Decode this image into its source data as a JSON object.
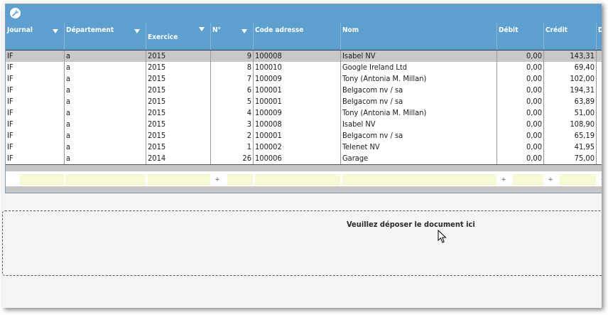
{
  "toolbar": {
    "icon": "wrench-icon"
  },
  "columns": [
    {
      "key": "journal",
      "label": "Journal",
      "sortable": true
    },
    {
      "key": "departement",
      "label": "Département",
      "sortable": true
    },
    {
      "key": "exercice",
      "label": "Exercice",
      "sortable": true
    },
    {
      "key": "numero",
      "label": "N°",
      "sortable": true
    },
    {
      "key": "code_adresse",
      "label": "Code adresse",
      "sortable": false
    },
    {
      "key": "nom",
      "label": "Nom",
      "sortable": false
    },
    {
      "key": "debit",
      "label": "Débit",
      "sortable": false
    },
    {
      "key": "credit",
      "label": "Crédit",
      "sortable": false
    },
    {
      "key": "extra",
      "label": "D",
      "sortable": false
    }
  ],
  "rows": [
    {
      "journal": "IF",
      "departement": "a",
      "exercice": "2015",
      "numero": "9",
      "code_adresse": "100008",
      "nom": "Isabel NV",
      "debit": "0,00",
      "credit": "143,31",
      "selected": true
    },
    {
      "journal": "IF",
      "departement": "a",
      "exercice": "2015",
      "numero": "8",
      "code_adresse": "100010",
      "nom": "Google Ireland Ltd",
      "debit": "0,00",
      "credit": "69,40",
      "selected": false
    },
    {
      "journal": "IF",
      "departement": "a",
      "exercice": "2015",
      "numero": "7",
      "code_adresse": "100009",
      "nom": "Tony (Antonia M. Millan)",
      "debit": "0,00",
      "credit": "102,00",
      "selected": false
    },
    {
      "journal": "IF",
      "departement": "a",
      "exercice": "2015",
      "numero": "6",
      "code_adresse": "100001",
      "nom": "Belgacom nv / sa",
      "debit": "0,00",
      "credit": "194,31",
      "selected": false
    },
    {
      "journal": "IF",
      "departement": "a",
      "exercice": "2015",
      "numero": "5",
      "code_adresse": "100001",
      "nom": "Belgacom nv / sa",
      "debit": "0,00",
      "credit": "63,89",
      "selected": false
    },
    {
      "journal": "IF",
      "departement": "a",
      "exercice": "2015",
      "numero": "4",
      "code_adresse": "100009",
      "nom": "Tony (Antonia M. Millan)",
      "debit": "0,00",
      "credit": "51,00",
      "selected": false
    },
    {
      "journal": "IF",
      "departement": "a",
      "exercice": "2015",
      "numero": "3",
      "code_adresse": "100008",
      "nom": "Isabel NV",
      "debit": "0,00",
      "credit": "108,90",
      "selected": false
    },
    {
      "journal": "IF",
      "departement": "a",
      "exercice": "2015",
      "numero": "2",
      "code_adresse": "100001",
      "nom": "Belgacom nv / sa",
      "debit": "0,00",
      "credit": "65,19",
      "selected": false
    },
    {
      "journal": "IF",
      "departement": "a",
      "exercice": "2015",
      "numero": "1",
      "code_adresse": "100002",
      "nom": "Telenet NV",
      "debit": "0,00",
      "credit": "41,95",
      "selected": false
    },
    {
      "journal": "IF",
      "departement": "a",
      "exercice": "2014",
      "numero": "26",
      "code_adresse": "100006",
      "nom": "Garage",
      "debit": "0,00",
      "credit": "75,00",
      "selected": false
    }
  ],
  "filters": {
    "operator_symbol": "÷"
  },
  "dropzone": {
    "text": "Veuillez déposer le document ici"
  },
  "colors": {
    "header": "#5da0cf",
    "selected_row": "#c8c8c8",
    "filter_input": "#f7f8d6"
  }
}
